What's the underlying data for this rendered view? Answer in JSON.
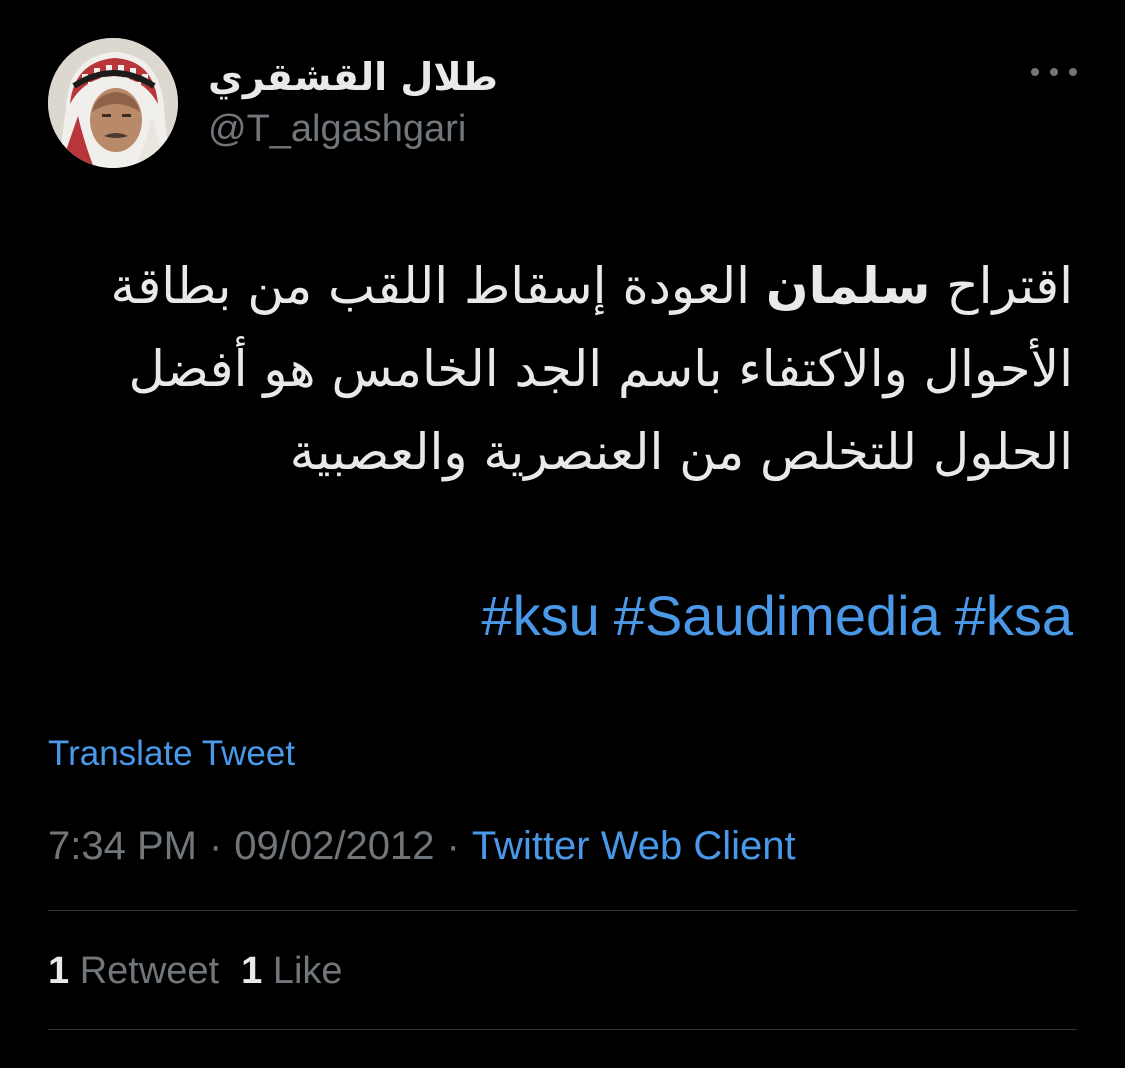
{
  "author": {
    "display_name": "طلال القشقري",
    "handle": "@T_algashgari",
    "avatar_icon": "user-avatar-photo"
  },
  "menu_icon": "more-options-icon",
  "tweet": {
    "text_before_bold": "اقتراح ",
    "text_bold": "سلمان",
    "text_after_bold": " العودة إسقاط اللقب من بطاقة الأحوال والاكتفاء باسم الجد الخامس هو أفضل الحلول للتخلص من العنصرية والعصبية",
    "hashtags": [
      "#ksu",
      "#Saudimedia",
      "#ksa"
    ]
  },
  "translate_label": "Translate Tweet",
  "meta": {
    "time": "7:34 PM",
    "separator": "·",
    "date": "09/02/2012",
    "source": "Twitter Web Client"
  },
  "stats": {
    "retweets_count": "1",
    "retweets_label": "Retweet",
    "likes_count": "1",
    "likes_label": "Like"
  },
  "colors": {
    "background": "#000000",
    "text_primary": "#e7e9ea",
    "text_secondary": "#71767b",
    "link": "#4a99e9",
    "divider": "#2f3336"
  }
}
